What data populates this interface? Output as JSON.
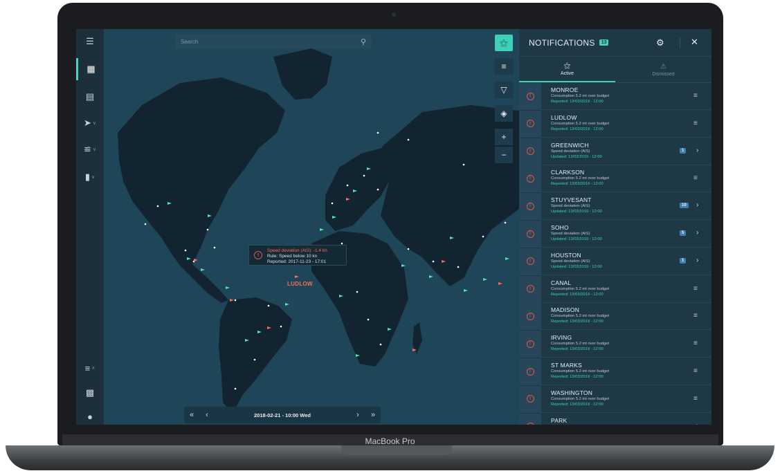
{
  "device": {
    "label": "MacBook Pro"
  },
  "search": {
    "placeholder": "Search"
  },
  "tooltip": {
    "title": "Speed deviation (AIS): -1.4 kn",
    "rule": "Rule: Speed below 10 kn",
    "reported": "Reported: 2017-11-23 - 17:01"
  },
  "map": {
    "ship_label": "LUDLOW"
  },
  "timeline": {
    "date": "2018-02-21 - 10:00 Wed"
  },
  "panel": {
    "title": "NOTIFICATIONS",
    "count": "13",
    "tabs": [
      {
        "label": "Active",
        "icon": "alarm-bell-icon"
      },
      {
        "label": "Dismissed",
        "icon": "bell-off-icon"
      }
    ]
  },
  "notifications": [
    {
      "name": "MONROE",
      "desc": "Consumption 5.2 mt over budget",
      "time": "Reported: 13/03/2019 - 12:00",
      "badge": "",
      "type": "menu"
    },
    {
      "name": "LUDLOW",
      "desc": "Consumption 5.2 mt over budget",
      "time": "Reported: 13/03/2019 - 12:00",
      "badge": "",
      "type": "menu"
    },
    {
      "name": "GREENWICH",
      "desc": "Speed deviation (AIS)",
      "time": "Updated: 13/03/2019 - 12:00",
      "badge": "1",
      "type": "chevron"
    },
    {
      "name": "CLARKSON",
      "desc": "Consumption 5.2 mt over budget",
      "time": "Reported: 13/03/2019 - 12:00",
      "badge": "",
      "type": "menu"
    },
    {
      "name": "STUYVESANT",
      "desc": "Speed deviation (AIS)",
      "time": "Updated: 13/03/2019 - 12:00",
      "badge": "10",
      "type": "chevron"
    },
    {
      "name": "SOHO",
      "desc": "Speed deviation (AIS)",
      "time": "Updated: 13/03/2019 - 12:00",
      "badge": "5",
      "type": "chevron"
    },
    {
      "name": "HOUSTON",
      "desc": "Speed deviation (AIS)",
      "time": "Updated: 13/03/2019 - 12:00",
      "badge": "1",
      "type": "chevron"
    },
    {
      "name": "CANAL",
      "desc": "Consumption 5.2 mt over budget",
      "time": "Reported: 13/03/2019 - 12:00",
      "badge": "",
      "type": "menu"
    },
    {
      "name": "MADISON",
      "desc": "Consumption 5.2 mt over budget",
      "time": "Reported: 13/03/2019 - 12:00",
      "badge": "",
      "type": "menu"
    },
    {
      "name": "IRVING",
      "desc": "Consumption 5.2 mt over budget",
      "time": "Reported: 13/03/2019 - 12:00",
      "badge": "",
      "type": "menu"
    },
    {
      "name": "ST MARKS",
      "desc": "Consumption 5.2 mt over budget",
      "time": "Reported: 13/03/2019 - 12:00",
      "badge": "",
      "type": "menu"
    },
    {
      "name": "WASHINGTON",
      "desc": "Consumption 5.2 mt over budget",
      "time": "Reported: 13/03/2019 - 12:00",
      "badge": "",
      "type": "menu"
    },
    {
      "name": "PARK",
      "desc": "",
      "time": "",
      "badge": "",
      "type": "chevron"
    }
  ],
  "icons": {
    "rail": [
      "menu-icon",
      "map-icon",
      "report-icon",
      "navigation-icon",
      "chart-icon",
      "fuel-icon",
      "sliders-icon",
      "contacts-icon",
      "user-icon"
    ],
    "map_tools": [
      "alarm-bell-icon",
      "list-icon",
      "filter-icon",
      "layers-icon",
      "zoom-in-icon",
      "zoom-out-icon"
    ]
  },
  "colors": {
    "accent": "#3fd1b8",
    "alert": "#e0564c",
    "map_water": "#1f4558",
    "land": "#12242f",
    "panel": "#1f3846"
  }
}
